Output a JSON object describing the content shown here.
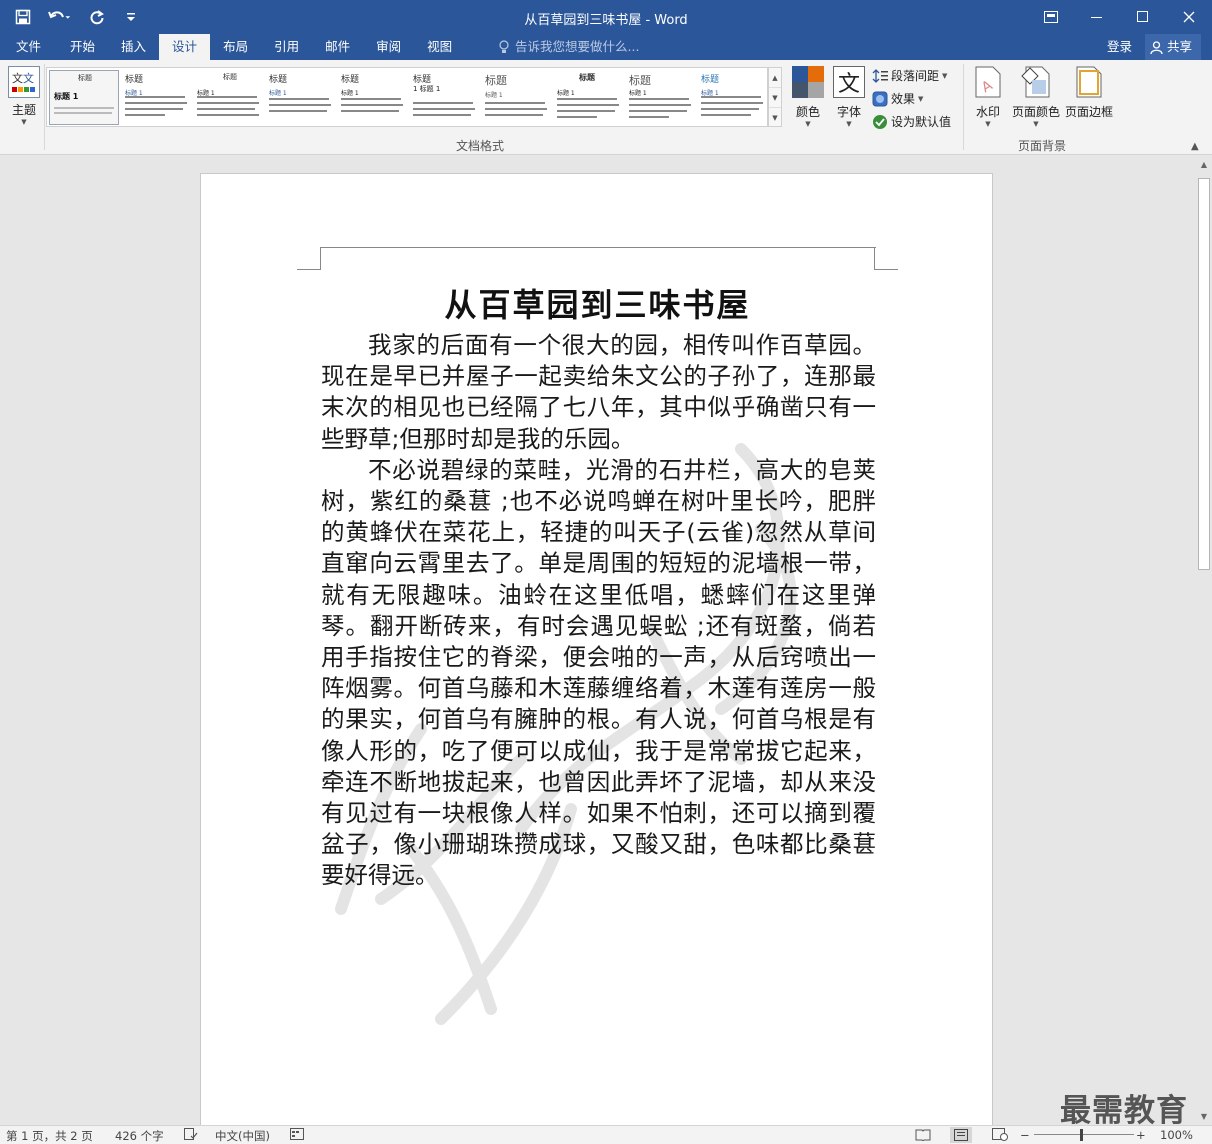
{
  "window": {
    "title": "从百草园到三味书屋 - Word"
  },
  "tabs": [
    {
      "label": "文件"
    },
    {
      "label": "开始"
    },
    {
      "label": "插入"
    },
    {
      "label": "设计"
    },
    {
      "label": "布局"
    },
    {
      "label": "引用"
    },
    {
      "label": "邮件"
    },
    {
      "label": "审阅"
    },
    {
      "label": "视图"
    }
  ],
  "tell_me": {
    "placeholder": "告诉我您想要做什么..."
  },
  "account": {
    "signin": "登录",
    "share": "共享"
  },
  "ribbon": {
    "theme_label": "主题",
    "gallery_label": "文档格式",
    "colors_label": "颜色",
    "fonts_label": "字体",
    "paragraph_spacing": "段落间距",
    "effects": "效果",
    "set_default": "设为默认值",
    "watermark": "水印",
    "page_color": "页面颜色",
    "page_borders": "页面边框",
    "background_group_label": "页面背景",
    "gallery_items": [
      {
        "title": "标题",
        "heading": "标题 1"
      },
      {
        "title": "标题",
        "heading": "标题 1"
      },
      {
        "title": "标题",
        "heading": "标题 1"
      },
      {
        "title": "标题",
        "heading": "标题 1"
      },
      {
        "title": "标题",
        "heading": "标题 1"
      },
      {
        "title": "标题",
        "heading": "1  标题 1"
      },
      {
        "title": "标题",
        "heading": "标题 1"
      },
      {
        "title": "标题",
        "heading": "标题 1"
      },
      {
        "title": "标题",
        "heading": "标题 1"
      },
      {
        "title": "标题",
        "heading": "标题 1"
      }
    ]
  },
  "document": {
    "title": "从百草园到三味书屋",
    "paragraphs": [
      "我家的后面有一个很大的园，相传叫作百草园。现在是早已并屋子一起卖给朱文公的子孙了，连那最末次的相见也已经隔了七八年，其中似乎确凿只有一些野草;但那时却是我的乐园。",
      "不必说碧绿的菜畦，光滑的石井栏，高大的皂荚树，紫红的桑葚 ;也不必说鸣蝉在树叶里长吟，肥胖的黄蜂伏在菜花上，轻捷的叫天子(云雀)忽然从草间直窜向云霄里去了。单是周围的短短的泥墙根一带，就有无限趣味。油蛉在这里低唱，蟋蟀们在这里弹琴。翻开断砖来，有时会遇见蜈蚣 ;还有斑蝥，倘若用手指按住它的脊梁，便会啪的一声，从后窍喷出一阵烟雾。何首乌藤和木莲藤缠络着，木莲有莲房一般的果实，何首乌有臃肿的根。有人说，何首乌根是有像人形的，吃了便可以成仙，我于是常常拔它起来，牵连不断地拔起来，也曾因此弄坏了泥墙，却从来没有见过有一块根像人样。如果不怕刺，还可以摘到覆盆子，像小珊瑚珠攒成球，又酸又甜，色味都比桑葚要好得远。"
    ]
  },
  "status": {
    "page": "第 1 页，共 2 页",
    "words": "426 个字",
    "language": "中文(中国)",
    "zoom": "100%"
  },
  "corner_brand": "最需教育",
  "colors": {
    "accent": "#2b579a",
    "ribbon_bg": "#f3f3f3",
    "canvas_bg": "#e6e6e6"
  }
}
